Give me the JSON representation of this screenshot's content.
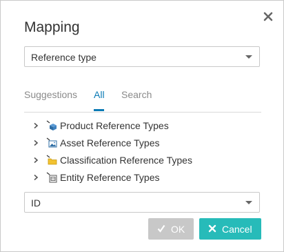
{
  "dialog": {
    "title": "Mapping",
    "close_icon": "close-icon"
  },
  "reference_select": {
    "value": "Reference type",
    "icon": "caret-down-icon"
  },
  "tabs": [
    {
      "label": "Suggestions",
      "active": false
    },
    {
      "label": "All",
      "active": true
    },
    {
      "label": "Search",
      "active": false
    }
  ],
  "tree": [
    {
      "label": "Product Reference Types",
      "icon": "product-reference-icon"
    },
    {
      "label": "Asset Reference Types",
      "icon": "asset-reference-icon"
    },
    {
      "label": "Classification Reference Types",
      "icon": "classification-reference-icon"
    },
    {
      "label": "Entity Reference Types",
      "icon": "entity-reference-icon"
    }
  ],
  "id_select": {
    "value": "ID",
    "icon": "caret-down-icon"
  },
  "buttons": {
    "ok": {
      "label": "OK",
      "icon": "check-icon",
      "enabled": false
    },
    "cancel": {
      "label": "Cancel",
      "icon": "close-icon"
    }
  },
  "colors": {
    "accent": "#0a7ab5",
    "cancel_button": "#27bbb9",
    "ok_button_disabled": "#c8c8c8"
  }
}
